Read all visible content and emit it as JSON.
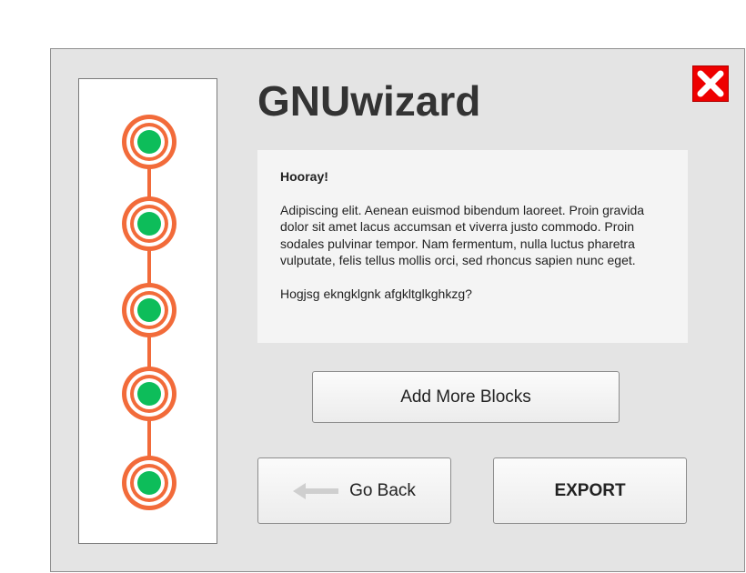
{
  "window": {
    "title": "GNUwizard"
  },
  "progress": {
    "steps": [
      {
        "state": "complete"
      },
      {
        "state": "complete"
      },
      {
        "state": "complete"
      },
      {
        "state": "complete"
      },
      {
        "state": "complete"
      }
    ],
    "colors": {
      "ring": "#f26b3a",
      "dot": "#0dbd5a"
    }
  },
  "message": {
    "heading": "Hooray!",
    "body": "Adipiscing elit. Aenean euismod bibendum laoreet. Proin gravida dolor sit amet lacus accumsan et viverra justo commodo. Proin sodales pulvinar tempor. Nam fermentum, nulla luctus pharetra vulputate, felis tellus mollis orci, sed rhoncus sapien nunc eget.",
    "question": "Hogjsg ekngklgnk afgkltglkghkzg?"
  },
  "buttons": {
    "add_more": "Add More Blocks",
    "go_back": "Go Back",
    "export": "EXPORT"
  },
  "icons": {
    "close": "close-icon",
    "back_arrow": "arrow-left-icon"
  },
  "colors": {
    "close_bg": "#ee0000"
  }
}
